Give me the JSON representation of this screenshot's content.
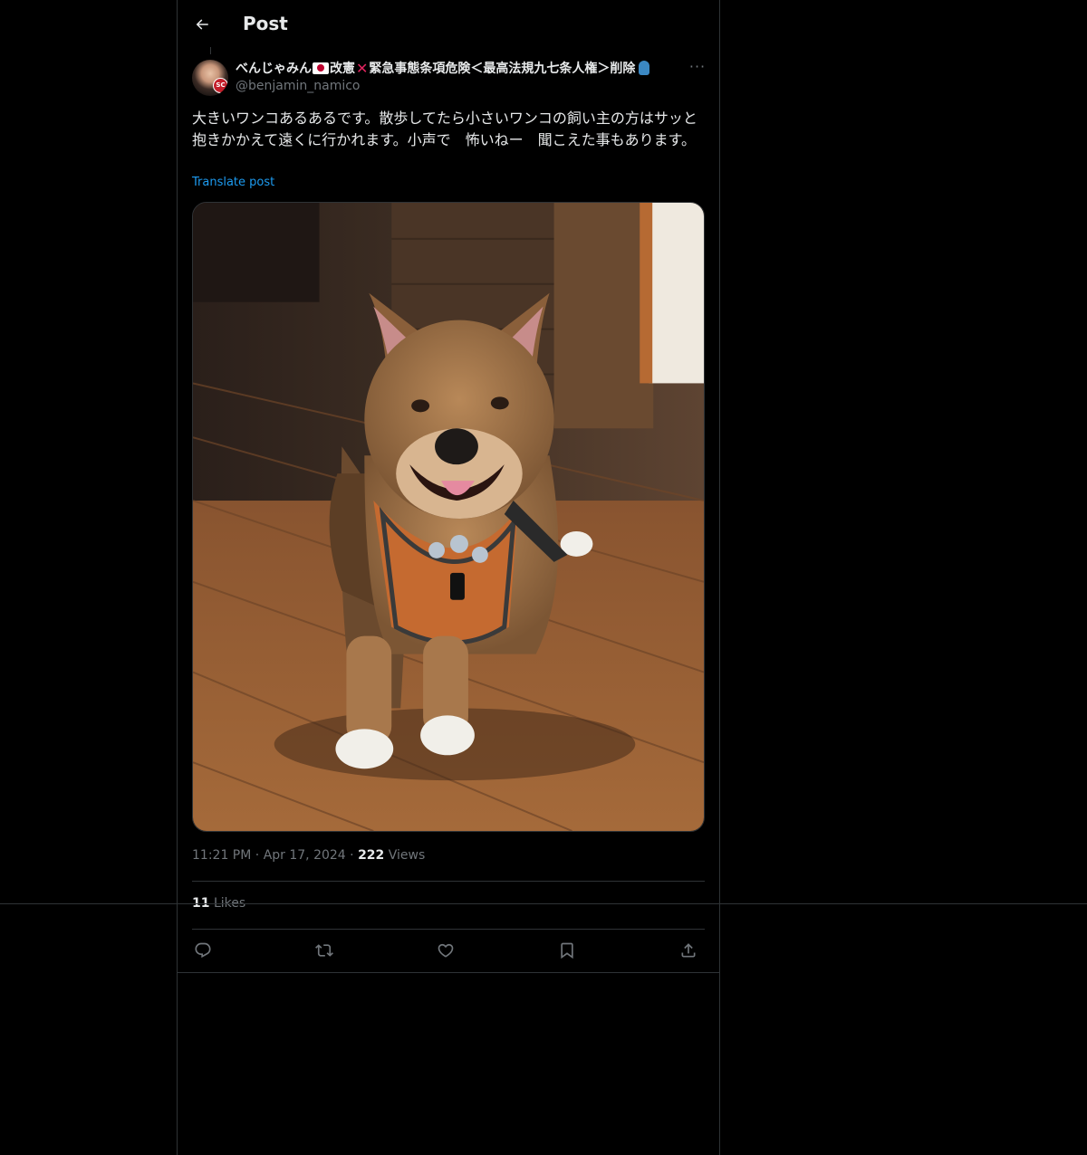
{
  "header": {
    "title": "Post"
  },
  "author": {
    "display_name_part1": "べんじゃみん",
    "display_name_part2": "改憲",
    "display_name_part3": "緊急事態条項危険＜最高法規九七条人権＞削除",
    "handle": "@benjamin_namico",
    "avatar_badge": "SC"
  },
  "post": {
    "text": "大きいワンコあるあるです。散歩してたら小さいワンコの飼い主の方はサッと抱きかかえて遠くに行かれます。小声で　怖いねー　聞こえた事もあります。",
    "translate_label": "Translate post",
    "time": "11:21 PM",
    "separator": "·",
    "date": "Apr 17, 2024",
    "views_count": "222",
    "views_label": "Views",
    "likes_count": "11",
    "likes_label": "Likes"
  },
  "icons": {
    "back": "arrow-left-icon",
    "more": "more-icon",
    "reply": "reply-icon",
    "repost": "repost-icon",
    "like": "like-icon",
    "bookmark": "bookmark-icon",
    "share": "share-icon"
  },
  "colors": {
    "background": "#000000",
    "text": "#e7e9ea",
    "muted": "#71767b",
    "link": "#1d9bf0",
    "border": "#2f3336"
  }
}
